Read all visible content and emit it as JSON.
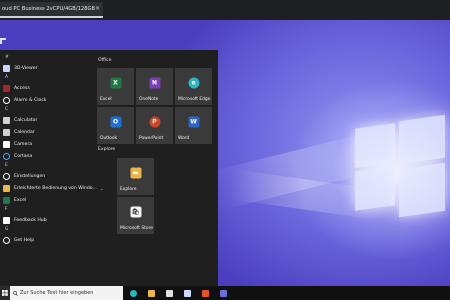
{
  "host": {
    "tab_title": "oud PC Business 2vCPU/4GB/128GB",
    "close_glyph": "×"
  },
  "list": {
    "entries": [
      {
        "type": "header",
        "label": "#"
      },
      {
        "type": "item",
        "label": "3D-Viewer",
        "icon": "cube-icon",
        "color": "#c9d4ff"
      },
      {
        "type": "header",
        "label": "A"
      },
      {
        "type": "item",
        "label": "Access",
        "icon": "access-icon",
        "color": "#a4262c"
      },
      {
        "type": "item",
        "label": "Alarm & Clock",
        "icon": "alarm-clock-icon",
        "color": "#ffffff"
      },
      {
        "type": "header",
        "label": "C"
      },
      {
        "type": "item",
        "label": "Calculator",
        "icon": "calculator-icon",
        "color": "#d0d0d0"
      },
      {
        "type": "item",
        "label": "Calendar",
        "icon": "calendar-icon",
        "color": "#d0d0d0"
      },
      {
        "type": "item",
        "label": "Camera",
        "icon": "camera-icon",
        "color": "#ffffff"
      },
      {
        "type": "item",
        "label": "Cortana",
        "icon": "cortana-icon",
        "color": "#4aa0ff"
      },
      {
        "type": "header",
        "label": "E"
      },
      {
        "type": "item",
        "label": "Einstellungen",
        "icon": "gear-icon",
        "color": "#ffffff"
      },
      {
        "type": "item",
        "label": "Erleichterte Bedienung von Windo...",
        "icon": "folder-icon",
        "color": "#e8b64a",
        "chevron": "⌄"
      },
      {
        "type": "item",
        "label": "Excel",
        "icon": "excel-icon",
        "color": "#1d7a45"
      },
      {
        "type": "header",
        "label": "F"
      },
      {
        "type": "item",
        "label": "Feedback Hub",
        "icon": "feedback-hub-icon",
        "color": "#ffffff"
      },
      {
        "type": "header",
        "label": "G"
      },
      {
        "type": "item",
        "label": "Get Help",
        "icon": "help-icon",
        "color": "#ffffff"
      }
    ]
  },
  "tiles": {
    "office_label": "Office",
    "explore_label": "Explore",
    "office": [
      {
        "label": "Excel",
        "icon": "excel-icon",
        "color": "#1d7a45",
        "glyph": "X"
      },
      {
        "label": "OneNote",
        "icon": "onenote-icon",
        "color": "#7b3fb8",
        "glyph": "N"
      },
      {
        "label": "Microsoft Edge",
        "icon": "edge-icon",
        "color": "#2fb5c4",
        "glyph": "e"
      },
      {
        "label": "Outlook",
        "icon": "outlook-icon",
        "color": "#1f6fd1",
        "glyph": "O"
      },
      {
        "label": "PowerPoint",
        "icon": "powerpoint-icon",
        "color": "#c8472a",
        "glyph": "P"
      },
      {
        "label": "Word",
        "icon": "word-icon",
        "color": "#2b64c4",
        "glyph": "W"
      }
    ],
    "explore": [
      {
        "label": "Explore",
        "icon": "file-explorer-icon",
        "color": "#e8b64a",
        "glyph": "▬"
      },
      {
        "label": "Microsoft Store",
        "icon": "store-icon",
        "color": "#f4f4f4",
        "glyph": "🛍"
      }
    ]
  },
  "taskbar": {
    "search_placeholder": "Zur Suche Text hier eingeben",
    "icons": [
      "edge-icon",
      "file-explorer-icon",
      "store-icon",
      "mail-icon",
      "office-icon",
      "teams-icon"
    ]
  }
}
